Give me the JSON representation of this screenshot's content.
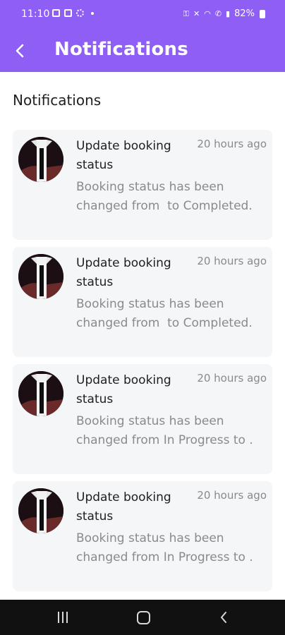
{
  "status_bar": {
    "time": "11:10",
    "battery": "82%"
  },
  "header": {
    "title": "Notifications"
  },
  "section": {
    "title": "Notifications"
  },
  "notifications": [
    {
      "title": "Update booking status",
      "time": "20 hours ago",
      "body": "Booking status has been changed from  to Completed."
    },
    {
      "title": "Update booking status",
      "time": "20 hours ago",
      "body": "Booking status has been changed from  to Completed."
    },
    {
      "title": "Update booking status",
      "time": "20 hours ago",
      "body": "Booking status has been changed from In Progress to ."
    },
    {
      "title": "Update booking status",
      "time": "20 hours ago",
      "body": "Booking status has been changed from In Progress to ."
    }
  ],
  "icons": {
    "back": "back-arrow-icon",
    "avatar": "user-avatar",
    "nav_recents": "recents-icon",
    "nav_home": "home-icon",
    "nav_back": "back-icon"
  },
  "colors": {
    "accent": "#8f5ff5",
    "card_bg": "#f5f6f8",
    "muted_text": "#8a8a8a"
  }
}
